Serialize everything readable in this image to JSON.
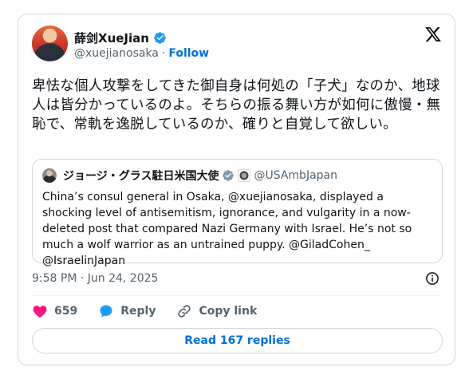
{
  "author": {
    "display_name": "薛剑XueJian",
    "handle": "@xuejianosaka",
    "separator": "·",
    "follow_label": "Follow"
  },
  "tweet": {
    "text": "卑怯な個人攻撃をしてきた御自身は何処の「子犬」なのか、地球人は皆分かっているのよ。そちらの振る舞い方が如何に傲慢・無恥で、常軌を逸脱しているのか、確りと自覚して欲しい。",
    "timestamp": "9:58 PM · Jun 24, 2025"
  },
  "quote": {
    "display_name": "ジョージ・グラス駐日米国大使",
    "handle": "@USAmbJapan",
    "text": "China’s consul general in Osaka, @xuejianosaka, displayed a shocking level of antisemitism, ignorance, and vulgarity in a now-deleted post that compared Nazi Germany with Israel. He’s not so much a wolf warrior as an untrained puppy. @GiladCohen_ @IsraelinJapan"
  },
  "actions": {
    "like_count": "659",
    "reply_label": "Reply",
    "copy_link_label": "Copy link"
  },
  "read_replies_label": "Read 167 replies",
  "colors": {
    "like": "#f91880",
    "reply": "#1d9bf0",
    "link": "#006fd6",
    "verified": "#1d9bf0",
    "muted": "#536471",
    "border": "#cfd9de"
  },
  "icons": [
    "verified-badge-icon",
    "x-logo-icon",
    "government-seal-icon",
    "info-icon",
    "heart-icon",
    "reply-icon",
    "link-icon"
  ]
}
